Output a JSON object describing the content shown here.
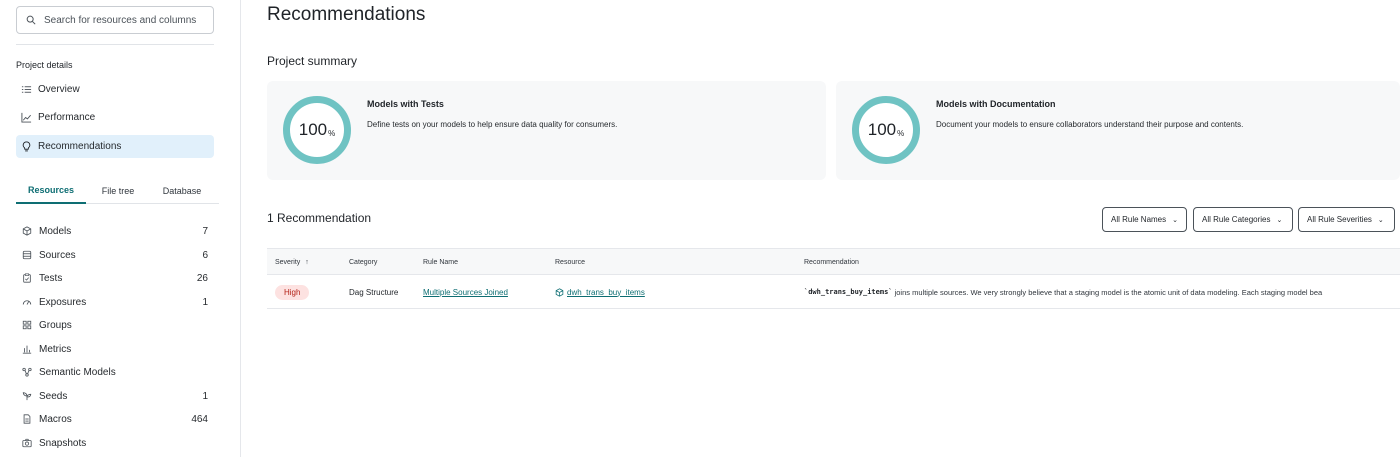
{
  "sidebar": {
    "search_placeholder": "Search for resources and columns",
    "project_details_label": "Project details",
    "nav": [
      {
        "label": "Overview",
        "icon": "list-icon"
      },
      {
        "label": "Performance",
        "icon": "chart-line-icon"
      },
      {
        "label": "Recommendations",
        "icon": "lightbulb-icon",
        "active": true
      }
    ],
    "tabs": [
      {
        "label": "Resources",
        "active": true
      },
      {
        "label": "File tree"
      },
      {
        "label": "Database"
      }
    ],
    "resources": [
      {
        "label": "Models",
        "count": "7",
        "icon": "cube-icon"
      },
      {
        "label": "Sources",
        "count": "6",
        "icon": "database-icon"
      },
      {
        "label": "Tests",
        "count": "26",
        "icon": "clipboard-icon"
      },
      {
        "label": "Exposures",
        "count": "1",
        "icon": "gauge-icon"
      },
      {
        "label": "Groups",
        "count": "",
        "icon": "grid-icon"
      },
      {
        "label": "Metrics",
        "count": "",
        "icon": "bar-chart-icon"
      },
      {
        "label": "Semantic Models",
        "count": "",
        "icon": "nodes-icon"
      },
      {
        "label": "Seeds",
        "count": "1",
        "icon": "seedling-icon"
      },
      {
        "label": "Macros",
        "count": "464",
        "icon": "file-icon"
      },
      {
        "label": "Snapshots",
        "count": "",
        "icon": "camera-icon"
      }
    ]
  },
  "main": {
    "title": "Recommendations",
    "summary_heading": "Project summary",
    "cards": [
      {
        "value": "100",
        "unit": "%",
        "title": "Models with Tests",
        "description": "Define tests on your models to help ensure data quality for consumers."
      },
      {
        "value": "100",
        "unit": "%",
        "title": "Models with Documentation",
        "description": "Document your models to ensure collaborators understand their purpose and contents."
      }
    ],
    "recommendation_count": "1 Recommendation",
    "filters": [
      "All Rule Names",
      "All Rule Categories",
      "All Rule Severities"
    ],
    "table": {
      "columns": [
        "Severity",
        "Category",
        "Rule Name",
        "Resource",
        "Recommendation"
      ],
      "sort_indicator": "↑",
      "rows": [
        {
          "severity": "High",
          "category": "Dag Structure",
          "rule_name": "Multiple Sources Joined",
          "resource": "dwh_trans_buy_items",
          "recommendation_code": "`dwh_trans_buy_items`",
          "recommendation_text": " joins multiple sources. We very strongly believe that a staging model is the atomic unit of data modeling. Each staging model bea"
        }
      ]
    }
  },
  "colors": {
    "accent": "#0e6e73",
    "ring": "#6fc3c3",
    "active_nav": "#e1f0fb",
    "badge_bg": "#fde2e1",
    "badge_text": "#b42318"
  }
}
